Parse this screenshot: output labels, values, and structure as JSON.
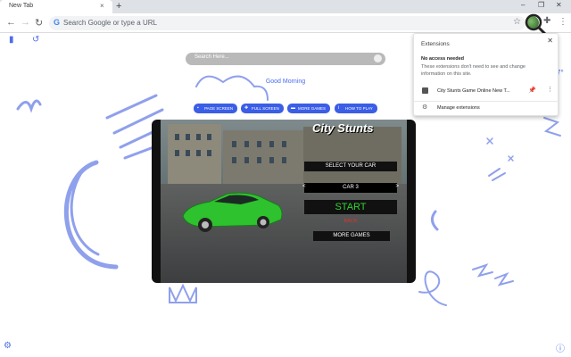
{
  "browser": {
    "tab_title": "New Tab",
    "tab_close_glyph": "×",
    "new_tab_glyph": "+",
    "window_controls": [
      "–",
      "❐",
      "✕"
    ],
    "omnibox_placeholder": "Search Google or type a URL",
    "corner_text": "7°"
  },
  "page": {
    "search_placeholder": "Search Here...",
    "greeting": "Good Morning",
    "buttons": [
      {
        "label": "PAGE SCREEN",
        "icon": "monitor-icon"
      },
      {
        "label": "FULL SCREEN",
        "icon": "expand-icon"
      },
      {
        "label": "MORE GAMES",
        "icon": "gamepad-icon"
      },
      {
        "label": "HOW TO PLAY",
        "icon": "info-icon"
      }
    ]
  },
  "game": {
    "title": "City Stunts",
    "select_car": "SELECT YOUR CAR",
    "car_label": "CAR 3",
    "prev_glyph": "<",
    "next_glyph": ">",
    "start": "START",
    "back": "BACK",
    "more_games": "MORE GAMES"
  },
  "extensions_popup": {
    "title": "Extensions",
    "section_heading": "No access needed",
    "section_desc": "These extensions don't need to see and change information on this site.",
    "extension_name": "City Stunts Game Online New T...",
    "manage_label": "Manage extensions"
  },
  "colors": {
    "accent": "#3b5ee6",
    "doodle": "#8fa0ec",
    "start_green": "#32d232",
    "back_red": "#e03030"
  }
}
